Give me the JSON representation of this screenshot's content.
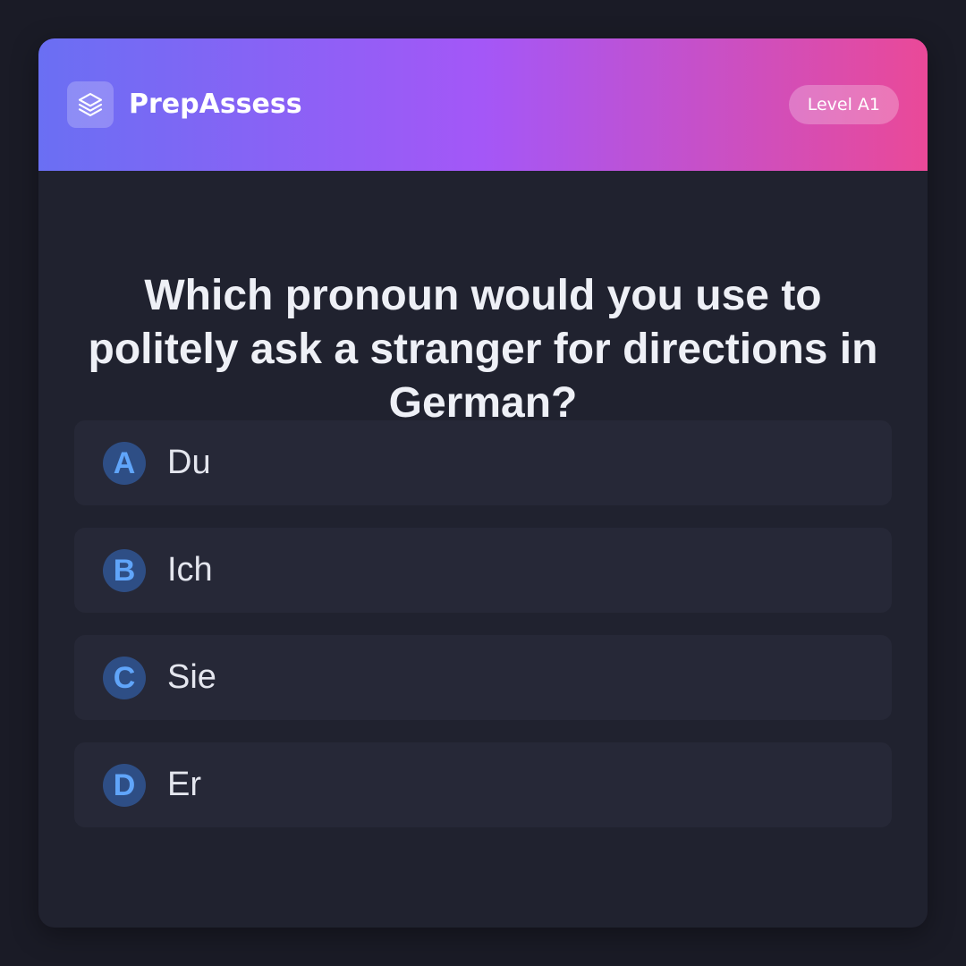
{
  "header": {
    "logo_icon": "layers-icon",
    "brand_name": "PrepAssess",
    "level_badge": "Level A1"
  },
  "question": {
    "text": "Which pronoun would you use to politely ask a stranger for directions in German?"
  },
  "options": [
    {
      "letter": "A",
      "text": "Du"
    },
    {
      "letter": "B",
      "text": "Ich"
    },
    {
      "letter": "C",
      "text": "Sie"
    },
    {
      "letter": "D",
      "text": "Er"
    }
  ],
  "colors": {
    "background": "#1a1b26",
    "card": "#20222f",
    "option_bg": "#262837",
    "gradient_start": "#6a6ff3",
    "gradient_mid": "#a457f7",
    "gradient_end": "#ea4998",
    "letter_badge_bg": "#2e4e85",
    "letter_badge_text": "#60a5fa"
  }
}
